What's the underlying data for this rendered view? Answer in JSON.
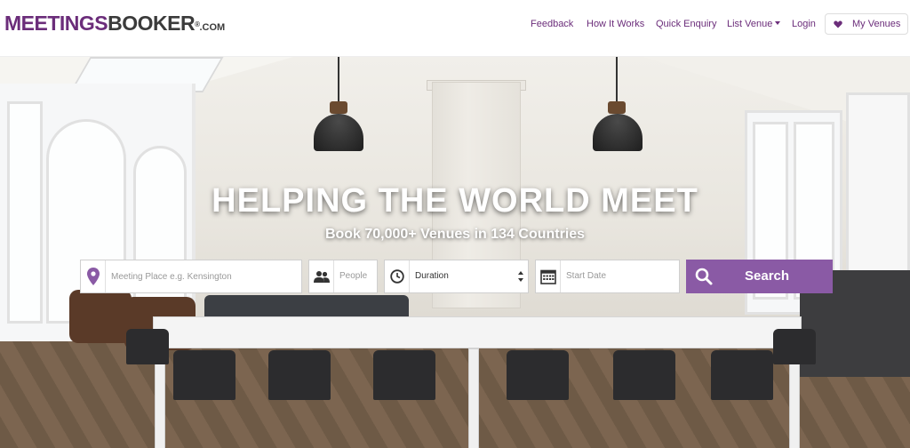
{
  "brand": {
    "logo_part1": "MEETINGS",
    "logo_part2": "BOOKER",
    "logo_reg": "®",
    "logo_tld": ".COM",
    "primary_color": "#6b2d7a",
    "button_color": "#8a5aa5"
  },
  "nav": {
    "feedback": "Feedback",
    "how_it_works": "How It Works",
    "quick_enquiry": "Quick Enquiry",
    "list_venue": "List Venue",
    "login": "Login",
    "my_venues": "My Venues"
  },
  "hero": {
    "headline": "HELPING THE WORLD MEET",
    "subheadline": "Book 70,000+ Venues in 134 Countries"
  },
  "search": {
    "place_placeholder": "Meeting Place e.g. Kensington",
    "people_placeholder": "People",
    "duration_value": "Duration",
    "date_placeholder": "Start Date",
    "button_label": "Search",
    "icons": [
      "map-pin-icon",
      "people-icon",
      "clock-icon",
      "calendar-icon",
      "magnifier-icon"
    ]
  }
}
